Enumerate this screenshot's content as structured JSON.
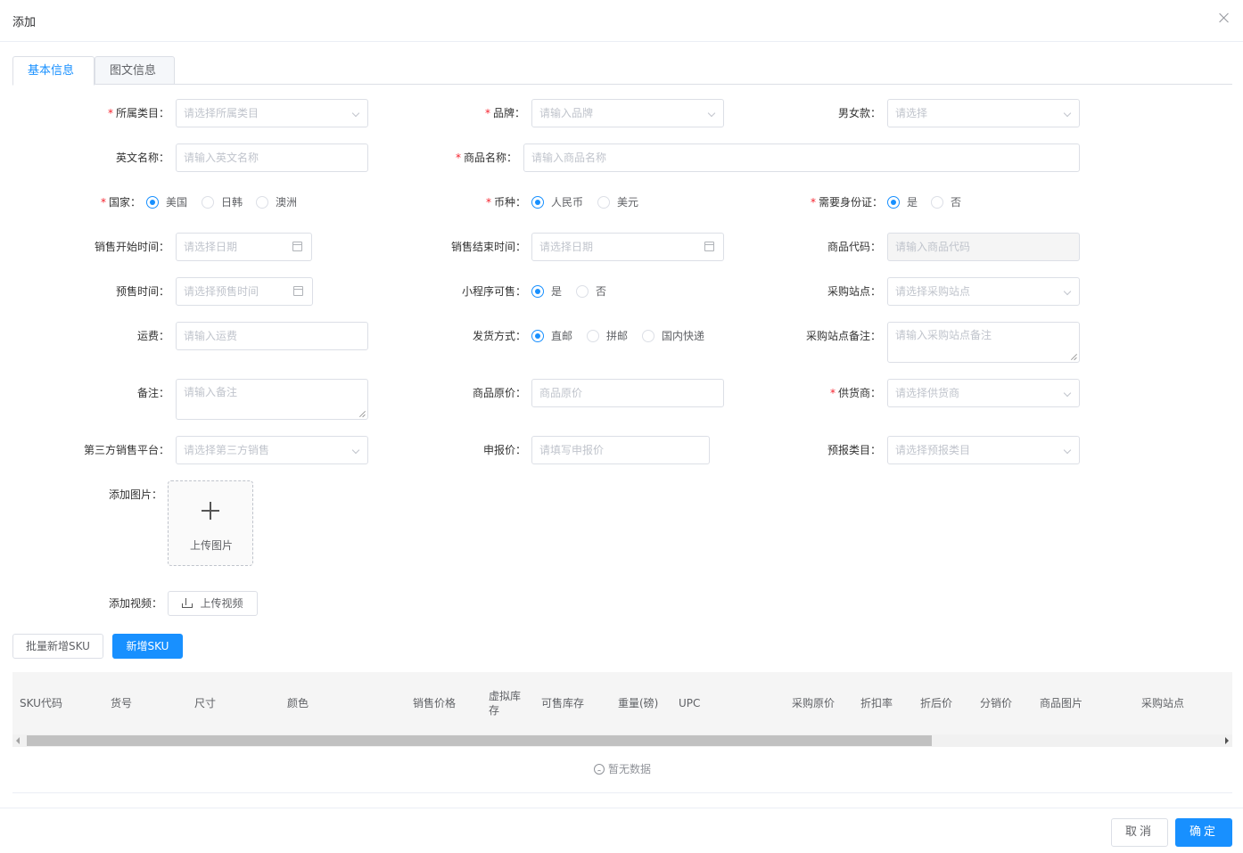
{
  "dialog": {
    "title": "添加"
  },
  "tabs": [
    "基本信息",
    "图文信息"
  ],
  "form": {
    "category": {
      "label": "所属类目：",
      "placeholder": "请选择所属类目"
    },
    "brand": {
      "label": "品牌：",
      "placeholder": "请输入品牌"
    },
    "gender": {
      "label": "男女款：",
      "placeholder": "请选择"
    },
    "english_name": {
      "label": "英文名称：",
      "placeholder": "请输入英文名称"
    },
    "product_name": {
      "label": "商品名称：",
      "placeholder": "请输入商品名称"
    },
    "country": {
      "label": "国家：",
      "options": [
        "美国",
        "日韩",
        "澳洲"
      ],
      "selected": "美国"
    },
    "currency": {
      "label": "币种：",
      "options": [
        "人民币",
        "美元"
      ],
      "selected": "人民币"
    },
    "id_required": {
      "label": "需要身份证：",
      "options": [
        "是",
        "否"
      ],
      "selected": "是"
    },
    "sale_start": {
      "label": "销售开始时间：",
      "placeholder": "请选择日期"
    },
    "sale_end": {
      "label": "销售结束时间：",
      "placeholder": "请选择日期"
    },
    "product_code": {
      "label": "商品代码：",
      "placeholder": "请输入商品代码"
    },
    "presale_time": {
      "label": "预售时间：",
      "placeholder": "请选择预售时间"
    },
    "miniprogram": {
      "label": "小程序可售：",
      "options": [
        "是",
        "否"
      ],
      "selected": "是"
    },
    "purchase_site": {
      "label": "采购站点：",
      "placeholder": "请选择采购站点"
    },
    "shipping_fee": {
      "label": "运费：",
      "placeholder": "请输入运费"
    },
    "delivery": {
      "label": "发货方式：",
      "options": [
        "直邮",
        "拼邮",
        "国内快递"
      ],
      "selected": "直邮"
    },
    "site_note": {
      "label": "采购站点备注：",
      "placeholder": "请输入采购站点备注"
    },
    "remark": {
      "label": "备注：",
      "placeholder": "请输入备注"
    },
    "original_price": {
      "label": "商品原价：",
      "placeholder": "商品原价"
    },
    "supplier": {
      "label": "供货商：",
      "placeholder": "请选择供货商"
    },
    "third_platform": {
      "label": "第三方销售平台：",
      "placeholder": "请选择第三方销售"
    },
    "declared_price": {
      "label": "申报价：",
      "placeholder": "请填写申报价"
    },
    "declared_category": {
      "label": "预报类目：",
      "placeholder": "请选择预报类目"
    },
    "image": {
      "label": "添加图片：",
      "button": "上传图片"
    },
    "video": {
      "label": "添加视频：",
      "button": "上传视频"
    }
  },
  "sku_actions": {
    "batch_add": "批量新增SKU",
    "add": "新增SKU"
  },
  "sku_table": {
    "columns": [
      "SKU代码",
      "货号",
      "尺寸",
      "颜色",
      "销售价格",
      "虚拟库存",
      "可售库存",
      "重量(磅)",
      "UPC",
      "采购原价",
      "折扣率",
      "折后价",
      "分销价",
      "商品图片",
      "采购站点"
    ],
    "empty_text": "暂无数据"
  },
  "footer": {
    "cancel": "取消",
    "confirm": "确定"
  },
  "colors": {
    "primary": "#1890ff",
    "required": "#f5222d"
  }
}
